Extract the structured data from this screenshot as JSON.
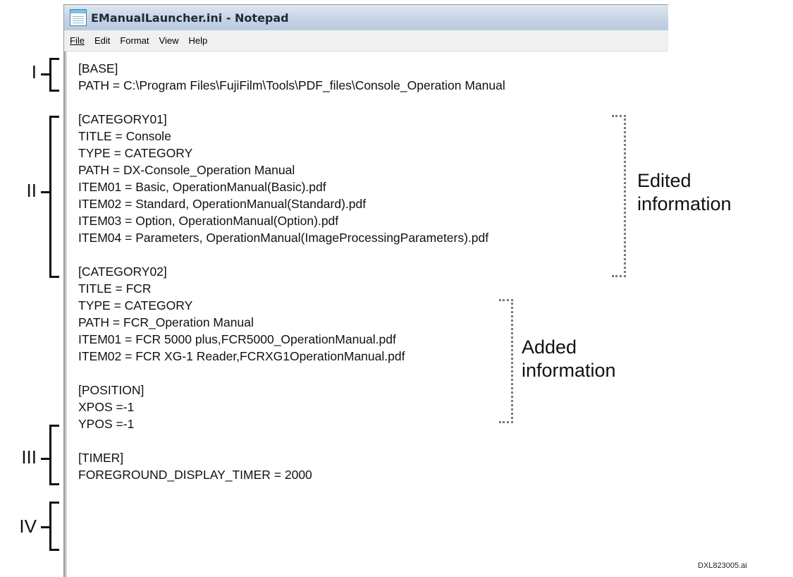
{
  "window": {
    "title": "EManualLauncher.ini - Notepad",
    "icon": "notepad-icon"
  },
  "menu": [
    {
      "label": "File"
    },
    {
      "label": "Edit"
    },
    {
      "label": "Format"
    },
    {
      "label": "View"
    },
    {
      "label": "Help"
    }
  ],
  "editor": {
    "lines": [
      "[BASE]",
      "PATH = C:\\Program Files\\FujiFilm\\Tools\\PDF_files\\Console_Operation Manual",
      "[CATEGORY01]",
      "TITLE = Console",
      "TYPE = CATEGORY",
      "PATH = DX-Console_Operation Manual",
      "ITEM01 = Basic, OperationManual(Basic).pdf",
      "ITEM02 = Standard, OperationManual(Standard).pdf",
      "ITEM03 = Option, OperationManual(Option).pdf",
      "ITEM04 = Parameters, OperationManual(ImageProcessingParameters).pdf",
      "[CATEGORY02]",
      "TITLE = FCR",
      "TYPE = CATEGORY",
      "PATH = FCR_Operation Manual",
      "ITEM01 = FCR 5000 plus,FCR5000_OperationManual.pdf",
      "ITEM02 = FCR XG-1 Reader,FCRXG1OperationManual.pdf",
      "[POSITION]",
      "XPOS =-1",
      "YPOS =-1",
      "[TIMER]",
      "FOREGROUND_DISPLAY_TIMER = 2000"
    ]
  },
  "sections": [
    {
      "label": "I"
    },
    {
      "label": "II"
    },
    {
      "label": "III"
    },
    {
      "label": "IV"
    }
  ],
  "annotations": {
    "edited": {
      "line1": "Edited",
      "line2": "information"
    },
    "added": {
      "line1": "Added",
      "line2": "information"
    }
  },
  "footnote": "DXL823005.ai"
}
